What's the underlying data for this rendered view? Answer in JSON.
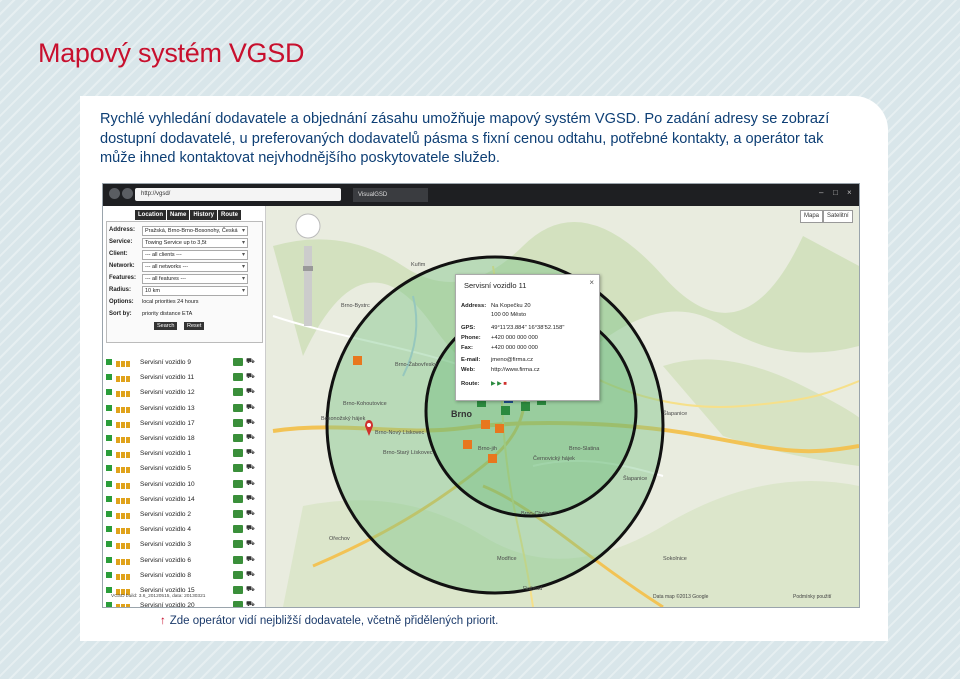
{
  "page": {
    "title": "Mapový systém VGSD",
    "intro": "Rychlé vyhledání dodavatele a objednání zásahu umožňuje mapový systém VGSD. Po zadání adresy se zobrazí dostupní dodavatelé, u preferovaných dodavatelů pásma s fixní cenou odtahu, potřebné kontakty, a operátor tak může ihned kontaktovat nejvhodnějšího poskytovatele služeb.",
    "caption": "Zde operátor vidí nejbližší dodavatele, včetně přidělených priorit.",
    "caption_arrow": "↑"
  },
  "browser": {
    "url": "http://vgsd/",
    "tab_title": "VisualGSD",
    "map_type_map": "Mapa",
    "map_type_satellite": "Satelitní"
  },
  "panel": {
    "tabs": [
      "Location",
      "Name",
      "History",
      "Route"
    ],
    "form": {
      "address_label": "Address:",
      "address_value": "Pražská, Brno-Brno-Bosonohy, Česká",
      "service_label": "Service:",
      "service_value": "Towing Service up to 3,5t",
      "client_label": "Client:",
      "client_value": "--- all clients ---",
      "network_label": "Network:",
      "network_value": "--- all networks ---",
      "features_label": "Features:",
      "features_value": "--- all features ---",
      "radius_label": "Radius:",
      "radius_value": "10 km",
      "options_label": "Options:",
      "options_value": "local priorities   24 hours",
      "sortby_label": "Sort by:",
      "sortby_value": "priority   distance   ETA",
      "search_button": "Search",
      "reset_button": "Reset"
    },
    "vehicles": [
      "Servisní vozidlo 9",
      "Servisní vozidlo 11",
      "Servisní vozidlo 12",
      "Servisní vozidlo 13",
      "Servisní vozidlo 17",
      "Servisní vozidlo 18",
      "Servisní vozidlo 1",
      "Servisní vozidlo 5",
      "Servisní vozidlo 10",
      "Servisní vozidlo 14",
      "Servisní vozidlo 2",
      "Servisní vozidlo 4",
      "Servisní vozidlo 3",
      "Servisní vozidlo 6",
      "Servisní vozidlo 8",
      "Servisní vozidlo 15",
      "Servisní vozidlo 20"
    ],
    "build": "VGSD build: 3.6_20120515, data: 20130321"
  },
  "popup": {
    "title": "Servisní vozidlo 11",
    "address_label": "Address:",
    "address_line1": "Na Kopečku 20",
    "address_line2": "100 00 Město",
    "gps_label": "GPS:",
    "gps_value": "49°11'23.884\" 16°38'52.158\"",
    "phone_label": "Phone:",
    "phone_value": "+420 000 000 000",
    "fax_label": "Fax:",
    "fax_value": "+420 000 000 000",
    "email_label": "E-mail:",
    "email_value": "jmeno@firma.cz",
    "web_label": "Web:",
    "web_value": "http://www.firma.cz",
    "route_label": "Route:"
  },
  "map": {
    "places": [
      "Brno",
      "Brno-Bystrc",
      "Brno-Žabovřesky",
      "Brno-Kohoutovice",
      "Brno-Nový Lískovec",
      "Brno-Starý Lískovec",
      "Brno-jih",
      "Brno-Slatina",
      "Černovický hájek",
      "Brno-Chrlice",
      "Bosonožský hájek",
      "Kuřim",
      "Šlapanice",
      "Modřice",
      "Šlapanice",
      "Ořechov",
      "Rajhrad",
      "Sokolnice"
    ],
    "credits": "Data map ©2013 Google",
    "terms": "Podmínky použití"
  },
  "colors": {
    "accent_red": "#c8102e",
    "text_blue": "#0e3f75",
    "radius_fill": "#7fc58a",
    "marker_orange": "#e8771e",
    "marker_green": "#2b8a3e"
  }
}
